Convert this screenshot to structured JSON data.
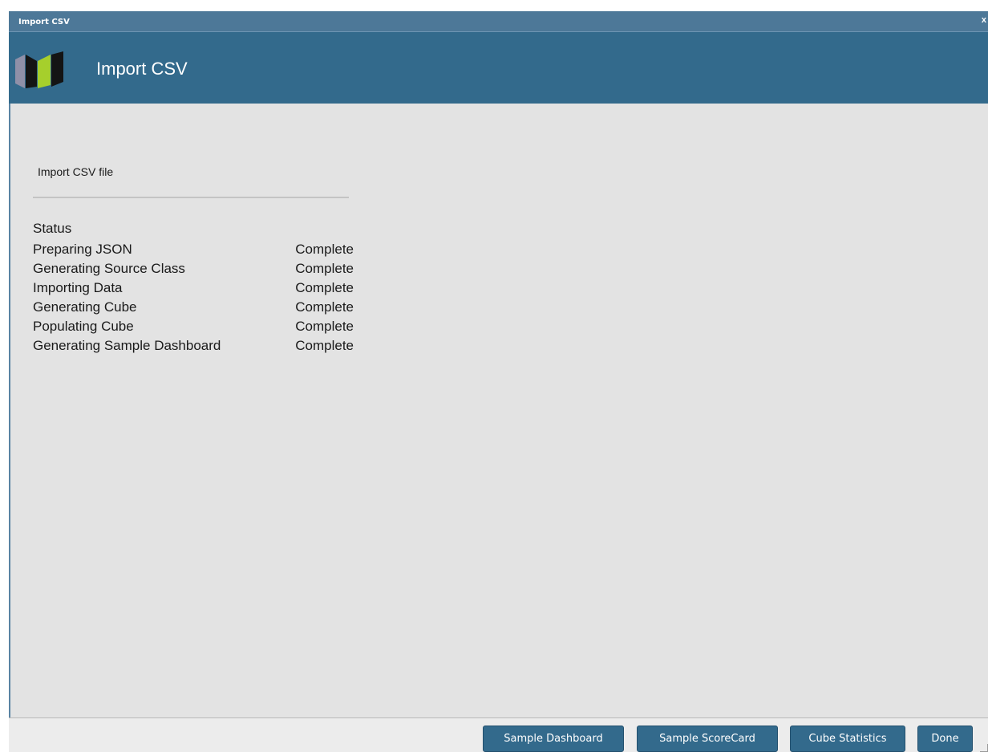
{
  "window": {
    "title": "Import CSV",
    "close_glyph": "x"
  },
  "banner": {
    "title": "Import CSV",
    "logo_icon": "bars-logo-icon"
  },
  "section": {
    "title": "Import CSV file"
  },
  "status": {
    "header": "Status",
    "steps": [
      {
        "name": "Preparing JSON",
        "state": "Complete"
      },
      {
        "name": "Generating Source Class",
        "state": "Complete"
      },
      {
        "name": "Importing Data",
        "state": "Complete"
      },
      {
        "name": "Generating Cube",
        "state": "Complete"
      },
      {
        "name": "Populating Cube",
        "state": "Complete"
      },
      {
        "name": "Generating Sample Dashboard",
        "state": "Complete"
      }
    ]
  },
  "footer": {
    "buttons": {
      "sample_dashboard": "Sample Dashboard",
      "sample_scorecard": "Sample ScoreCard",
      "cube_statistics": "Cube Statistics",
      "done": "Done"
    }
  },
  "colors": {
    "titlebar": "#4d7898",
    "banner": "#336a8c",
    "button": "#336a8c",
    "body": "#e3e3e3",
    "logo_gray": "#8f90a8",
    "logo_green": "#a6cf2c",
    "logo_dark": "#141414"
  }
}
